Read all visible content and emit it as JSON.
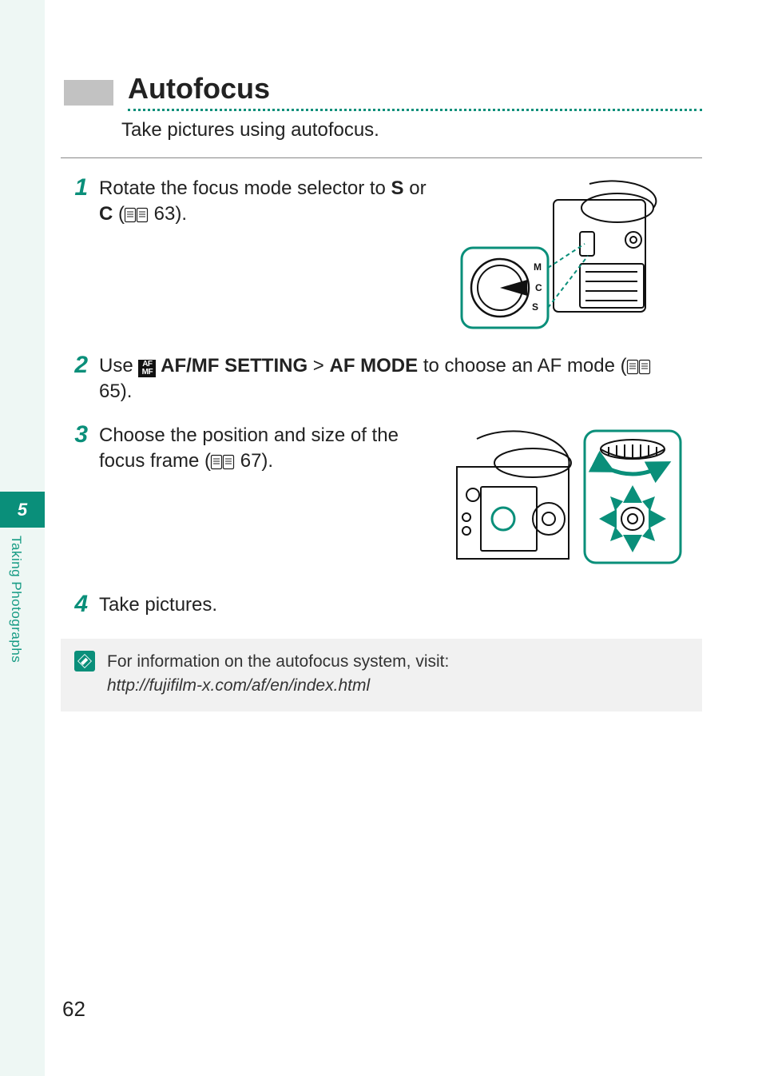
{
  "chapter": {
    "number": "5",
    "name": "Taking Photographs"
  },
  "heading": "Autofocus",
  "lede": "Take pictures using autofocus.",
  "steps": {
    "s1": {
      "num": "1",
      "t1": "Rotate the focus mode selector to ",
      "s": "S",
      "t2": "or ",
      "c": "C",
      "t3": " (",
      "ref": " 63).",
      "dial": {
        "m": "M",
        "c": "C",
        "s": "S"
      }
    },
    "s2": {
      "num": "2",
      "t1": "Use ",
      "setting": " AF/MF SETTING",
      "gt": " > ",
      "mode": "AF MODE",
      "t2": " to choose an AF mode (",
      "ref": " 65)."
    },
    "s3": {
      "num": "3",
      "t1": "Choose the position and size of the focus frame (",
      "ref": " 67)."
    },
    "s4": {
      "num": "4",
      "t1": "Take pictures."
    }
  },
  "note": {
    "line1": "For information on the autofocus system, visit:",
    "url": "http://fujifilm-x.com/af/en/index.html"
  },
  "pageNumber": "62",
  "iconLabels": {
    "afmf_line1": "AF",
    "afmf_line2": "MF"
  }
}
